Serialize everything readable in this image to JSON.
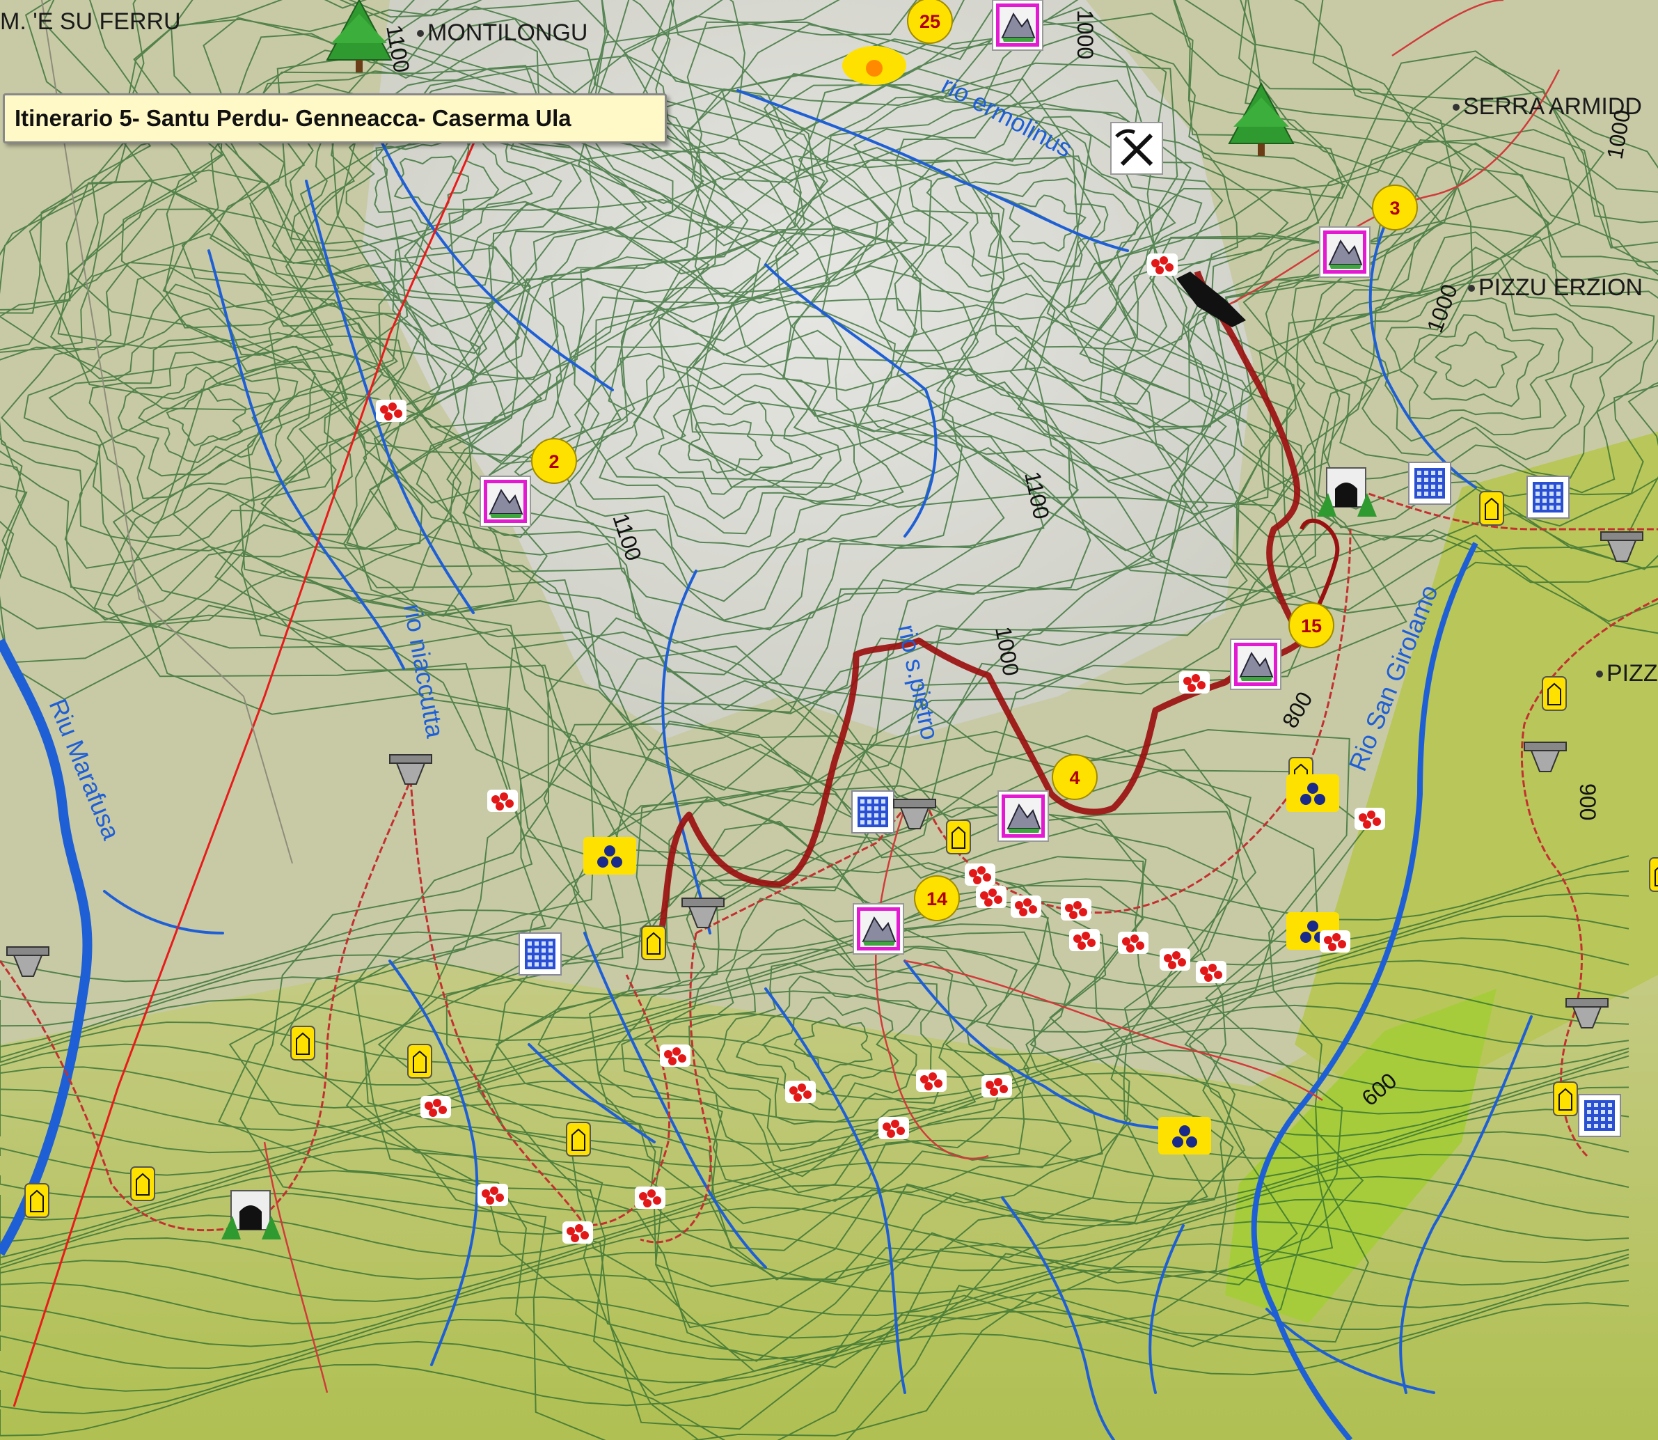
{
  "map": {
    "title": "Itinerario 5- Santu Perdu- Genneacca- Caserma Ula",
    "colors": {
      "terrain_high": "#d9d9d6",
      "terrain_mid": "#c6c8a4",
      "terrain_low": "#b9c65a",
      "contour": "#2d6b2d",
      "river": "#1f5fd6",
      "route": "#9a1010",
      "trail": "#c33030",
      "waypoint": "#ffe100",
      "peak_icon": "#e31ad2"
    },
    "place_labels": [
      "M. 'E SU FERRU",
      "MONTILONGU",
      "SERRA ARMIDD",
      "PIZZU ERZION",
      "PIZZ"
    ],
    "river_labels": [
      "rio ermolinus",
      "rio s.pietro",
      "rio niaccutta",
      "Riu Marafusa",
      "Rio San Girolamo"
    ],
    "contour_labels": [
      "1100",
      "1100",
      "1100",
      "1000",
      "1000",
      "1000",
      "1000",
      "800",
      "900",
      "600"
    ],
    "waypoints": [
      "25",
      "2",
      "3",
      "4",
      "15",
      "14"
    ],
    "icons": {
      "peak": "mountain-peak-icon",
      "tree": "pine-tree-icon",
      "tunnel": "tunnel-icon",
      "building": "building-icon",
      "hut": "hut-icon",
      "bridge": "bridge-icon",
      "mine": "pick-shovel-icon",
      "vineyard": "grape-icon",
      "flowers": "flower-cluster-icon",
      "sunrise": "sunrise-icon"
    }
  }
}
